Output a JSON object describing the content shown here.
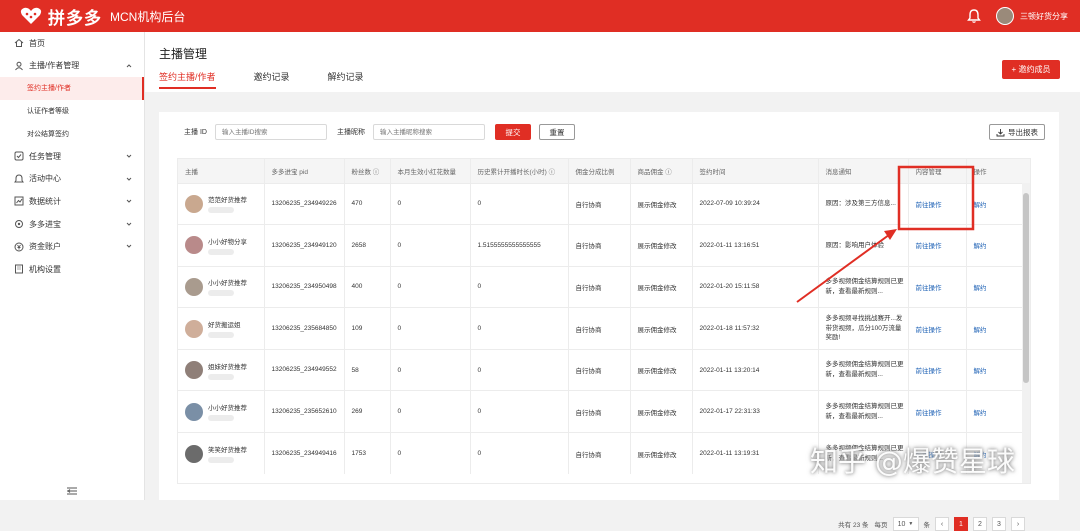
{
  "topbar": {
    "brand": "拼多多",
    "subtitle": "MCN机构后台",
    "user_name": "三顿好货分享",
    "brand_color": "#e02e24"
  },
  "sidebar": {
    "items": [
      {
        "label": "首页",
        "icon": "home-icon"
      },
      {
        "label": "主播/作者管理",
        "icon": "user-icon",
        "expanded": true
      },
      {
        "label": "签约主播/作者",
        "sub": true,
        "active": true
      },
      {
        "label": "认证作者等级",
        "sub": true
      },
      {
        "label": "对公结算签约",
        "sub": true
      },
      {
        "label": "任务管理",
        "icon": "task-icon"
      },
      {
        "label": "活动中心",
        "icon": "bell-icon"
      },
      {
        "label": "数据统计",
        "icon": "chart-icon"
      },
      {
        "label": "多多进宝",
        "icon": "gear-icon"
      },
      {
        "label": "资金账户",
        "icon": "wallet-icon"
      },
      {
        "label": "机构设置",
        "icon": "building-icon"
      }
    ]
  },
  "header": {
    "title": "主播管理",
    "tabs": [
      "签约主播/作者",
      "邀约记录",
      "解约记录"
    ],
    "invite_button": "+ 邀约成员"
  },
  "filter": {
    "anchor_id_label": "主播 ID",
    "anchor_id_placeholder": "输入主播ID搜索",
    "nickname_label": "主播昵称",
    "nickname_placeholder": "输入主播昵称搜索",
    "submit": "提交",
    "reset": "重置",
    "export": "导出报表"
  },
  "table": {
    "columns": [
      "主播",
      "多多进宝 pid",
      "粉丝数 ⓘ",
      "本月生效小红花数量",
      "历史累计开播时长(小时) ⓘ",
      "佣金分成比例",
      "商品佣金 ⓘ",
      "签约时间",
      "消息通知",
      "内容管理",
      "操作"
    ],
    "rows": [
      {
        "name": "范范好货推荐",
        "pid": "13206235_234949226",
        "fans": "470",
        "flowers": "0",
        "hours": "0",
        "ratio": "自行协商",
        "commission": "展示佣金修改",
        "signed": "2022-07-09 10:39:24",
        "notice": "原因：涉及第三方信息...",
        "content": "前往操作",
        "action": "解约"
      },
      {
        "name": "小小好物分享",
        "pid": "13206235_234949120",
        "fans": "2658",
        "flowers": "0",
        "hours": "1.5155555555555555",
        "ratio": "自行协商",
        "commission": "展示佣金修改",
        "signed": "2022-01-11 13:16:51",
        "notice": "原因：影响用户体验",
        "content": "前往操作",
        "action": "解约"
      },
      {
        "name": "小小好货推荐",
        "pid": "13206235_234950498",
        "fans": "400",
        "flowers": "0",
        "hours": "0",
        "ratio": "自行协商",
        "commission": "展示佣金修改",
        "signed": "2022-01-20 15:11:58",
        "notice": "多多视频佣金结算规则已更新，查看最新规则...",
        "content": "前往操作",
        "action": "解约"
      },
      {
        "name": "好货搬运姐",
        "pid": "13206235_235684850",
        "fans": "109",
        "flowers": "0",
        "hours": "0",
        "ratio": "自行协商",
        "commission": "展示佣金修改",
        "signed": "2022-01-18 11:57:32",
        "notice": "多多视频寻找挑战赛开...发带货视频，瓜分100万流量奖励!",
        "content": "前往操作",
        "action": "解约"
      },
      {
        "name": "姐妹好货推荐",
        "pid": "13206235_234949552",
        "fans": "58",
        "flowers": "0",
        "hours": "0",
        "ratio": "自行协商",
        "commission": "展示佣金修改",
        "signed": "2022-01-11 13:20:14",
        "notice": "多多视频佣金结算规则已更新，查看最新规则...",
        "content": "前往操作",
        "action": "解约"
      },
      {
        "name": "小小好货推荐",
        "pid": "13206235_235652610",
        "fans": "269",
        "flowers": "0",
        "hours": "0",
        "ratio": "自行协商",
        "commission": "展示佣金修改",
        "signed": "2022-01-17 22:31:33",
        "notice": "多多视频佣金结算规则已更新，查看最新规则...",
        "content": "前往操作",
        "action": "解约"
      },
      {
        "name": "笑笑好货推荐",
        "pid": "13206235_234949416",
        "fans": "1753",
        "flowers": "0",
        "hours": "0",
        "ratio": "自行协商",
        "commission": "展示佣金修改",
        "signed": "2022-01-11 13:19:31",
        "notice": "多多视频佣金结算规则已更新，查看最新规则...",
        "content": "前往操作",
        "action": "解约"
      }
    ]
  },
  "pagination": {
    "total": "共有 23 条",
    "per_page_label": "每页",
    "per_page": "10",
    "per_page_unit": "条",
    "pages": [
      "1",
      "2",
      "3"
    ],
    "current": "1"
  },
  "watermark": "知乎 @爆赞星球"
}
